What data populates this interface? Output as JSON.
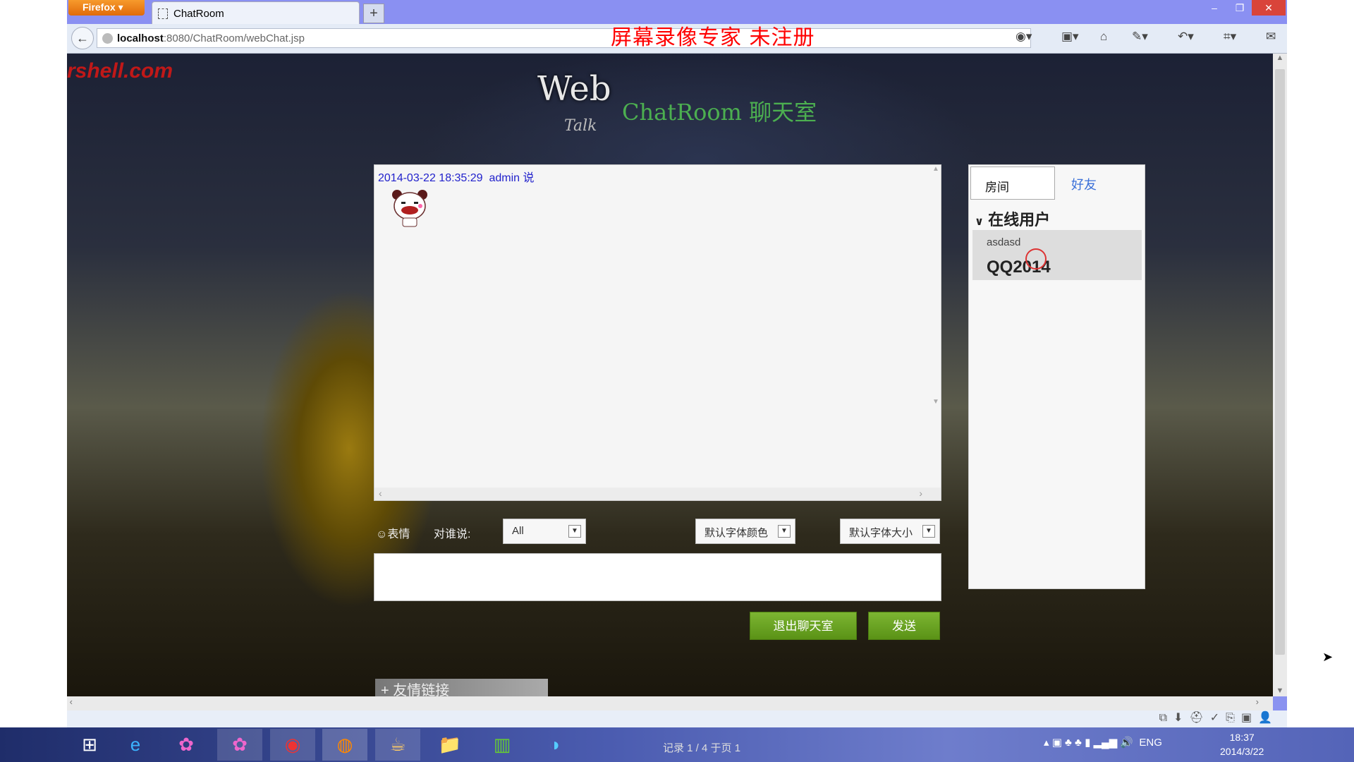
{
  "browser": {
    "menu_label": "Firefox ▾",
    "tab_title": "ChatRoom",
    "new_tab": "+",
    "url_host": "localhost",
    "url_rest": ":8080/ChatRoom/webChat.jsp",
    "win_controls": [
      "–",
      "❐",
      "✕"
    ]
  },
  "watermark": "屏幕录像专家  未注册",
  "site": {
    "logo_text": "rshell.com",
    "title_web": "Web",
    "title_talk": "Talk",
    "title_main": "ChatRoom 聊天室"
  },
  "chat": {
    "messages": [
      {
        "time": "2014-03-22 18:35:29",
        "user": "admin",
        "verb": "说",
        "content": "bear-emoticon"
      }
    ]
  },
  "toolbar": {
    "emoticon_label": "表情",
    "to_label": "对谁说:",
    "to_value": "All",
    "color_value": "默认字体颜色",
    "size_value": "默认字体大小"
  },
  "buttons": {
    "exit": "退出聊天室",
    "send": "发送"
  },
  "links_label": "+ 友情链接",
  "panel": {
    "tabs": [
      "房间",
      "好友"
    ],
    "online_header": "在线用户",
    "users": [
      "asdasd",
      "QQ2014"
    ]
  },
  "taskbar": {
    "record_text": "记录 1 / 4 于页 1",
    "language": "ENG",
    "time": "18:37",
    "date": "2014/3/22"
  }
}
